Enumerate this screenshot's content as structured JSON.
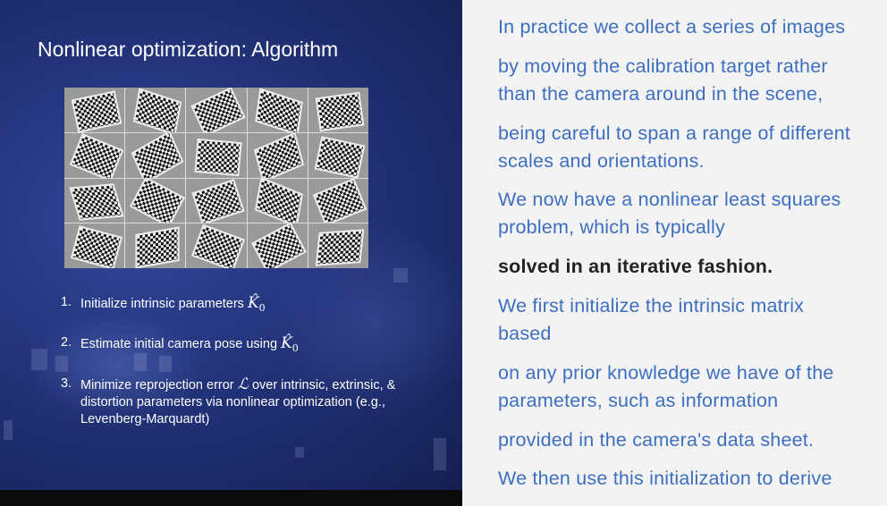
{
  "slide": {
    "title": "Nonlinear optimization: Algorithm",
    "steps": [
      {
        "num": "1.",
        "text": "Initialize intrinsic parameters ",
        "math": "K̂",
        "sub": "0"
      },
      {
        "num": "2.",
        "text": "Estimate initial camera pose using ",
        "math": "K̂",
        "sub": "0"
      },
      {
        "num": "3.",
        "text_a": "Minimize reprojection error ",
        "math": "ℒ",
        "text_b": " over intrinsic, extrinsic, & distortion parameters via nonlinear optimization (e.g., Levenberg-Marquardt)"
      }
    ]
  },
  "transcript": {
    "lines": [
      "In practice we collect a series of images",
      "by moving the calibration target rather",
      "than the camera around in the scene,",
      "being careful to span a range of different",
      "scales and orientations.",
      "We now have a nonlinear least squares",
      "problem, which is typically",
      "solved in an iterative fashion.",
      "We first initialize the intrinsic matrix",
      "based",
      "on any prior knowledge we have of the",
      "parameters, such as information",
      "provided in the camera's data sheet.",
      "We then use this initialization to derive"
    ]
  }
}
